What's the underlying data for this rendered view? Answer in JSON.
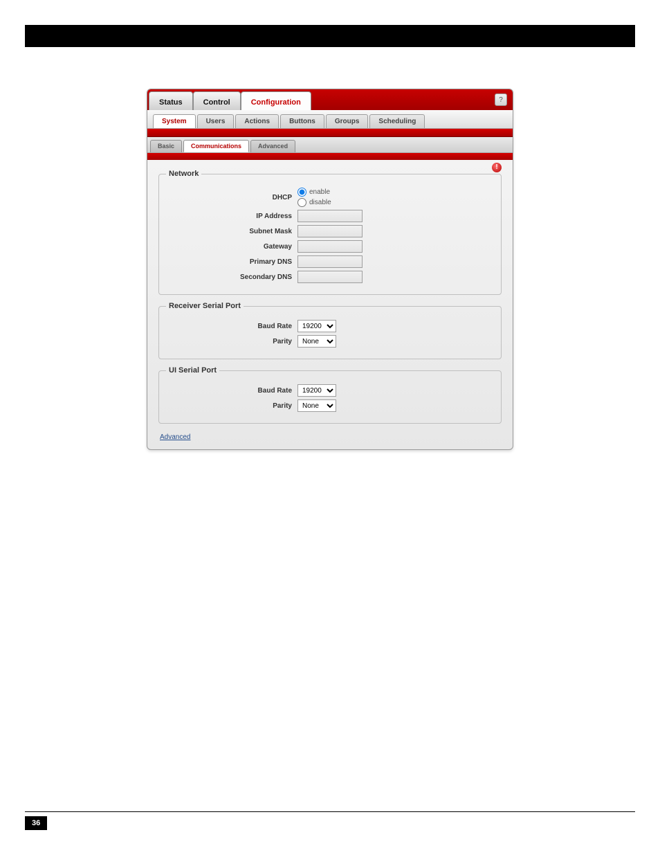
{
  "mainTabs": [
    "Status",
    "Control",
    "Configuration"
  ],
  "subTabs": [
    "System",
    "Users",
    "Actions",
    "Buttons",
    "Groups",
    "Scheduling"
  ],
  "tabs3": [
    "Basic",
    "Communications",
    "Advanced"
  ],
  "network": {
    "legend": "Network",
    "dhcp": {
      "label": "DHCP",
      "enable": "enable",
      "disable": "disable"
    },
    "ip": "IP Address",
    "subnet": "Subnet Mask",
    "gateway": "Gateway",
    "pdns": "Primary DNS",
    "sdns": "Secondary DNS"
  },
  "receiver": {
    "legend": "Receiver Serial Port",
    "baudLabel": "Baud Rate",
    "baudValue": "19200",
    "parityLabel": "Parity",
    "parityValue": "None"
  },
  "uiSerial": {
    "legend": "UI Serial Port",
    "baudLabel": "Baud Rate",
    "baudValue": "19200",
    "parityLabel": "Parity",
    "parityValue": "None"
  },
  "advancedLink": "Advanced",
  "pageNumber": "36"
}
